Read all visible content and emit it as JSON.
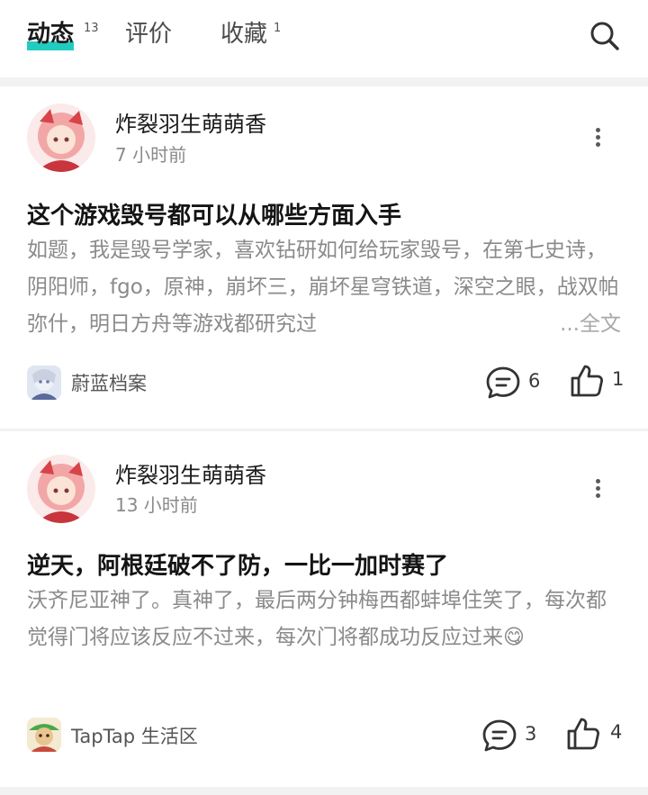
{
  "tabs": [
    {
      "label": "动态",
      "badge": "13"
    },
    {
      "label": "评价",
      "badge": ""
    },
    {
      "label": "收藏",
      "badge": "1"
    }
  ],
  "icons": {
    "search": "search-icon",
    "more": "more-vertical-icon",
    "comment": "comment-icon",
    "like": "thumbs-up-icon"
  },
  "colors": {
    "accent": "#22cbc1",
    "muted_text": "#8a8a8a"
  },
  "posts": [
    {
      "author": "炸裂羽生萌萌香",
      "time": "7 小时前",
      "title": "这个游戏毁号都可以从哪些方面入手",
      "body": "如题，我是毁号学家，喜欢钻研如何给玩家毁号，在第七史诗，阴阳师，fgo，原神，崩坏三，崩坏星穹铁道，深空之眼，战双帕弥什，明日方舟等游戏都研究过",
      "more_label": "...全文",
      "forum": "蔚蓝档案",
      "comments": "6",
      "likes": "1"
    },
    {
      "author": "炸裂羽生萌萌香",
      "time": "13 小时前",
      "title": "逆天，阿根廷破不了防，一比一加时赛了",
      "body": "沃齐尼亚神了。真神了，最后两分钟梅西都蚌埠住笑了，每次都觉得门将应该反应不过来，每次门将都成功反应过来😋",
      "forum": "TapTap 生活区",
      "comments": "3",
      "likes": "4"
    }
  ]
}
